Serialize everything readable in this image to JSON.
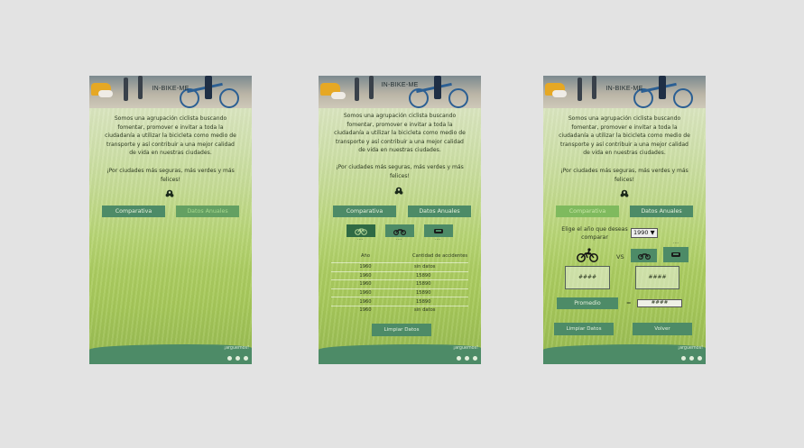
{
  "app": {
    "title": "IN-BIKE-ME",
    "intro": "Somos una agrupación ciclista buscando fomentar, promover e invitar a toda la ciudadanía a utilizar la bicicleta como medio de transporte y así contribuir a una mejor calidad de vida en nuestras ciudades.",
    "slogan": "¡Por ciudades más seguras, más verdes y más felices!",
    "brand": "¡arguemos!",
    "colors": {
      "primary": "#4d8b67",
      "active": "#7fba5e",
      "dark": "#2f6a44"
    }
  },
  "tabs": {
    "comparativa": "Comparativa",
    "datos_anuales": "Datos Anuales"
  },
  "vehicles": [
    {
      "icon": "bicycle-icon",
      "dots": "...."
    },
    {
      "icon": "motorcycle-icon",
      "dots": "...."
    },
    {
      "icon": "car-icon",
      "dots": "...."
    }
  ],
  "table": {
    "headers": [
      "Año",
      "Cantidad de accidentes"
    ],
    "rows": [
      [
        "1960",
        "sin datos"
      ],
      [
        "1960",
        "15890"
      ],
      [
        "1960",
        "15890"
      ],
      [
        "1960",
        "15890"
      ],
      [
        "1960",
        "15890"
      ],
      [
        "1960",
        "sin datos"
      ]
    ]
  },
  "buttons": {
    "limpiar": "Limpiar Datos",
    "volver": "Volver",
    "promedio": "Promedio"
  },
  "comparison": {
    "select_label": "Elige el año que deseas comparar",
    "year": "1990 ▼",
    "vs": "VS",
    "value_a": "####",
    "value_b": "####",
    "equals": "=",
    "result": "####"
  }
}
